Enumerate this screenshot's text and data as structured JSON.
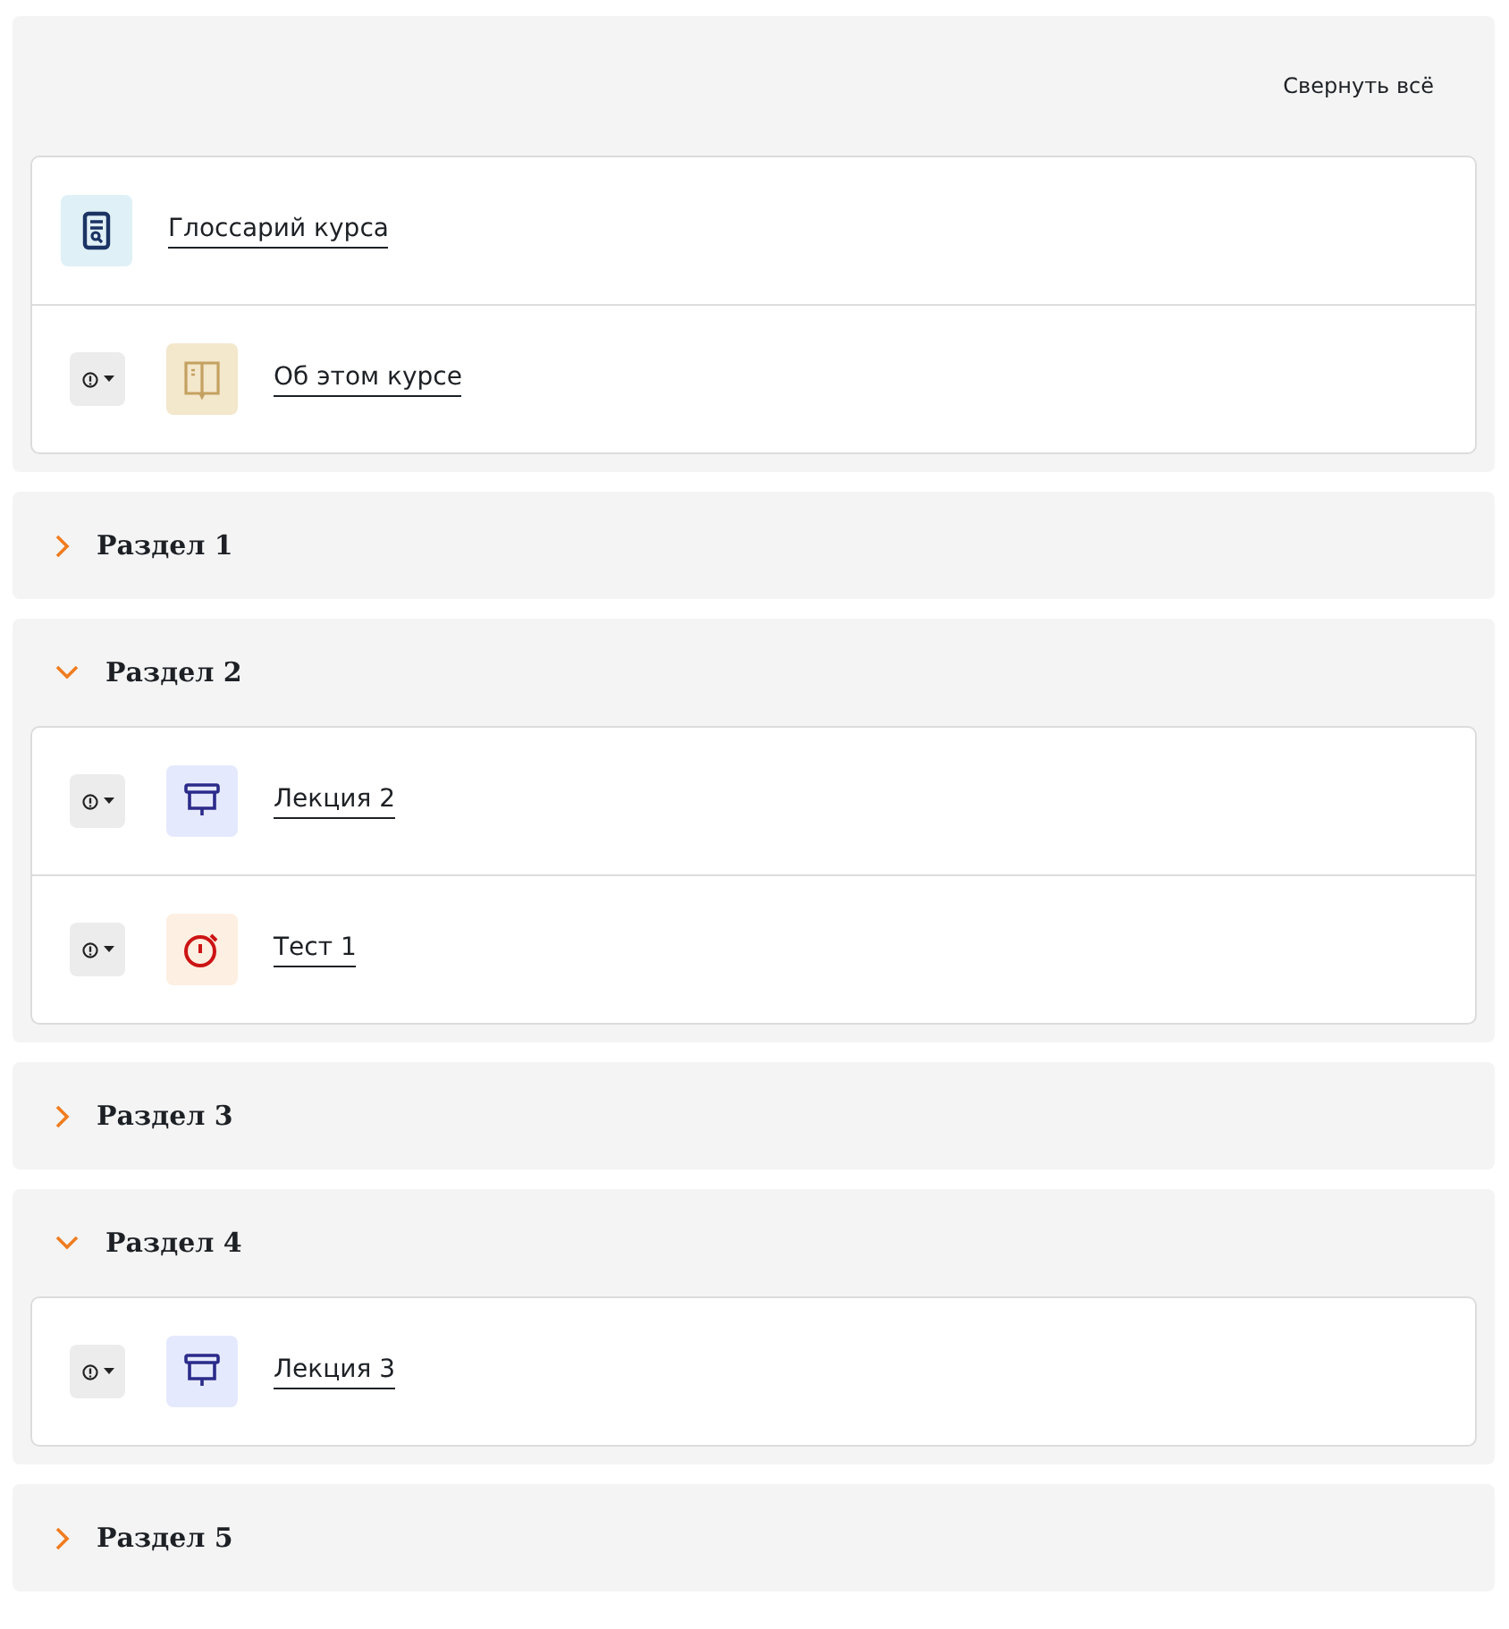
{
  "collapse_all": "Свернуть всё",
  "general": {
    "items": [
      {
        "kind": "glossary",
        "title": "Глоссарий курса",
        "info_menu": false
      },
      {
        "kind": "page",
        "title": "Об этом курсе",
        "info_menu": true
      }
    ]
  },
  "sections": [
    {
      "title": "Раздел 1",
      "expanded": false
    },
    {
      "title": "Раздел 2",
      "expanded": true,
      "items": [
        {
          "kind": "lecture",
          "title": "Лекция 2",
          "info_menu": true
        },
        {
          "kind": "quiz",
          "title": "Тест 1",
          "info_menu": true
        }
      ]
    },
    {
      "title": "Раздел 3",
      "expanded": false
    },
    {
      "title": "Раздел 4",
      "expanded": true,
      "items": [
        {
          "kind": "lecture",
          "title": "Лекция 3",
          "info_menu": true
        }
      ]
    },
    {
      "title": "Раздел 5",
      "expanded": false
    }
  ]
}
